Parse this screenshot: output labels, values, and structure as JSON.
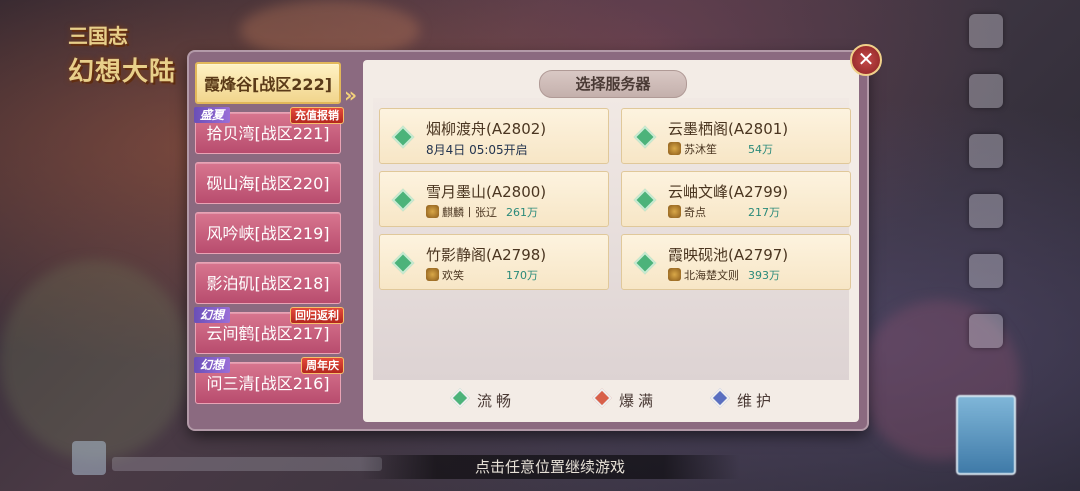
{
  "logo": {
    "line1": "三国志",
    "line2": "幻想大陆"
  },
  "panel": {
    "title": "选择服务器",
    "close_symbol": "✕"
  },
  "tabs": [
    {
      "label": "霞烽谷[战区222]",
      "active": true,
      "tag_left": "",
      "tag_right": ""
    },
    {
      "label": "拾贝湾[战区221]",
      "active": false,
      "tag_left": "盛夏",
      "tag_right": "充值报销"
    },
    {
      "label": "砚山海[战区220]",
      "active": false,
      "tag_left": "",
      "tag_right": ""
    },
    {
      "label": "风吟峡[战区219]",
      "active": false,
      "tag_left": "",
      "tag_right": ""
    },
    {
      "label": "影泊矶[战区218]",
      "active": false,
      "tag_left": "",
      "tag_right": ""
    },
    {
      "label": "云间鹤[战区217]",
      "active": false,
      "tag_left": "幻想",
      "tag_right": "回归返利"
    },
    {
      "label": "问三清[战区216]",
      "active": false,
      "tag_left": "幻想",
      "tag_right": "周年庆"
    }
  ],
  "servers": [
    {
      "name": "烟柳渡舟(A2802)",
      "status": "smooth",
      "open_time": "8月4日 05:05开启",
      "player": "",
      "power": ""
    },
    {
      "name": "云墨栖阁(A2801)",
      "status": "smooth",
      "open_time": "",
      "player": "苏沐笙",
      "power": "54万"
    },
    {
      "name": "雪月墨山(A2800)",
      "status": "smooth",
      "open_time": "",
      "player": "麒麟丨张辽",
      "power": "261万"
    },
    {
      "name": "云岫文峰(A2799)",
      "status": "smooth",
      "open_time": "",
      "player": "奇点",
      "power": "217万"
    },
    {
      "name": "竹影静阁(A2798)",
      "status": "smooth",
      "open_time": "",
      "player": "欢笑",
      "power": "170万"
    },
    {
      "name": "霞映砚池(A2797)",
      "status": "smooth",
      "open_time": "",
      "player": "北海楚文则",
      "power": "393万"
    }
  ],
  "legend": [
    {
      "label": "流畅",
      "color": "#4cb37a"
    },
    {
      "label": "爆满",
      "color": "#d8604a"
    },
    {
      "label": "维护",
      "color": "#5a6fc0"
    }
  ],
  "footer": {
    "continue_text": "点击任意位置继续游戏"
  }
}
